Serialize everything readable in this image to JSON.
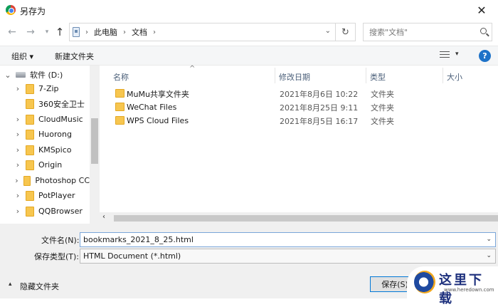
{
  "window": {
    "title": "另存为",
    "close_glyph": "✕"
  },
  "navbar": {
    "back_glyph": "←",
    "forward_glyph": "→",
    "history_glyph": "▾",
    "up_glyph": "↑",
    "breadcrumb": [
      "此电脑",
      "文档"
    ],
    "sep_glyph": "›",
    "address_dropdown_glyph": "⌄",
    "refresh_glyph": "↻",
    "search_placeholder": "搜索\"文档\""
  },
  "toolbar": {
    "organize_label": "组织 ▾",
    "new_folder_label": "新建文件夹",
    "view_dropdown_glyph": "▾",
    "help_glyph": "?"
  },
  "tree": {
    "root": {
      "caret": "⌄",
      "label": "软件 (D:)"
    },
    "items": [
      {
        "caret": "›",
        "label": "7-Zip"
      },
      {
        "caret": "",
        "label": "360安全卫士"
      },
      {
        "caret": "›",
        "label": "CloudMusic"
      },
      {
        "caret": "›",
        "label": "Huorong"
      },
      {
        "caret": "›",
        "label": "KMSpico"
      },
      {
        "caret": "›",
        "label": "Origin"
      },
      {
        "caret": "›",
        "label": "Photoshop CC"
      },
      {
        "caret": "›",
        "label": "PotPlayer"
      },
      {
        "caret": "›",
        "label": "QQBrowser"
      }
    ]
  },
  "columns": {
    "name": "名称",
    "date": "修改日期",
    "type": "类型",
    "size": "大小",
    "sort_glyph": "^"
  },
  "files": [
    {
      "name": "MuMu共享文件夹",
      "date": "2021年8月6日 10:22",
      "type": "文件夹"
    },
    {
      "name": "WeChat Files",
      "date": "2021年8月25日 9:11",
      "type": "文件夹"
    },
    {
      "name": "WPS Cloud Files",
      "date": "2021年8月5日 16:17",
      "type": "文件夹"
    }
  ],
  "hscroll_left_glyph": "‹",
  "form": {
    "filename_label": "文件名(N):",
    "filename_value": "bookmarks_2021_8_25.html",
    "type_label": "保存类型(T):",
    "type_value": "HTML Document (*.html)",
    "dropdown_glyph": "⌄"
  },
  "bottom": {
    "hide_caret": "▴",
    "hide_label": "隐藏文件夹",
    "save_label": "保存(S)"
  },
  "watermark": {
    "text": "这里下载",
    "url": "www.heredown.com"
  }
}
